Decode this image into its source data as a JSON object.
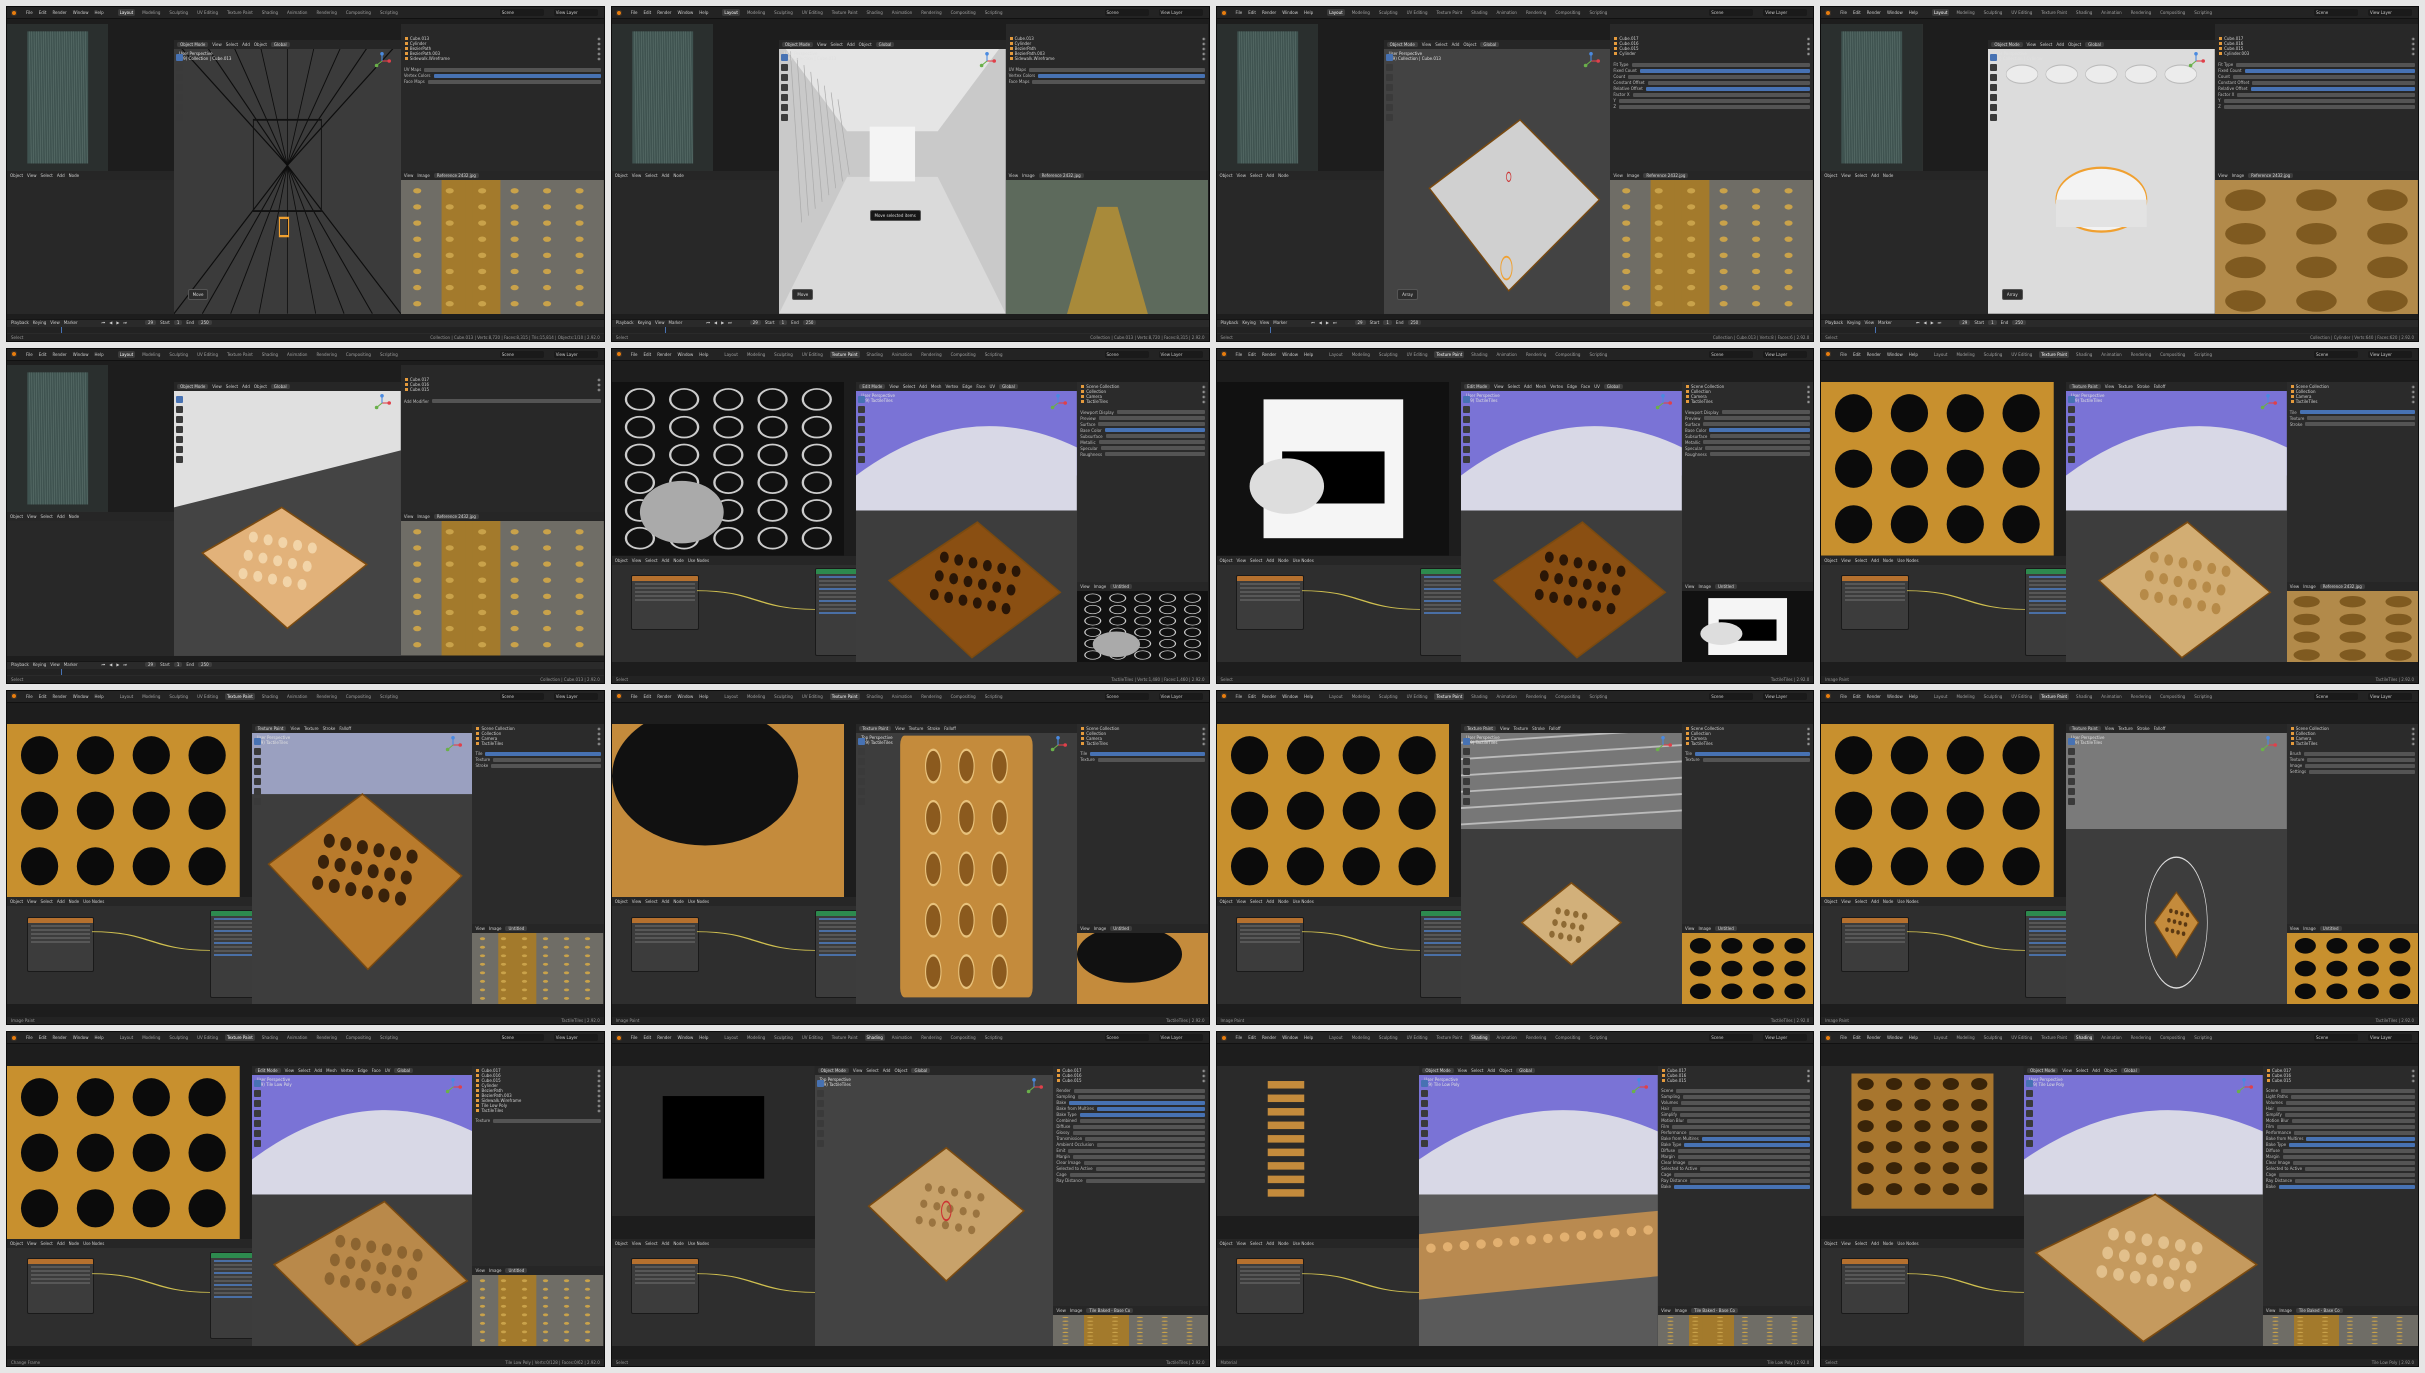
{
  "app": {
    "menu": [
      "File",
      "Edit",
      "Render",
      "Window",
      "Help"
    ],
    "workspaces": [
      "Layout",
      "Modeling",
      "Sculpting",
      "UV Editing",
      "Texture Paint",
      "Shading",
      "Animation",
      "Rendering",
      "Compositing",
      "Scripting"
    ],
    "scene": "Scene",
    "view_layer": "View Layer"
  },
  "colors": {
    "accent": "#4772b3",
    "tile_orange": "#c7882c",
    "blender_orange": "#e87d0d",
    "ui_dark": "#1d1d1d",
    "ui_panel": "#303030",
    "sky_purple": "#7a73d6"
  },
  "frames": [
    {
      "workspace": "Layout",
      "mode": "Object Mode",
      "header": [
        "View",
        "Select",
        "Add",
        "Object"
      ],
      "orientation": "Global",
      "caption": [
        "User Perspective",
        "(29) Collection | Cube.013"
      ],
      "scene_kind": "wireframe",
      "outliner": [
        "Cube.013",
        "Cylinder",
        "BezierPath",
        "BezierPath.003",
        "Sidewalk.Wireframe"
      ],
      "props": [
        "UV Maps",
        "Vertex Colors",
        "Face Maps"
      ],
      "image_title": "Reference 2432.jpg",
      "ref_kind": "tiles",
      "panel_label": "Move",
      "timeline": [
        "Playback",
        "Keying",
        "View",
        "Marker"
      ],
      "status_left": "Select",
      "status_right": "Collection | Cube.013 | Verts:8,720 | Faces:8,315 | Tris:15,814 | Objects:1/10 | 2.92.0",
      "frame_current": "29",
      "frame_start": "1",
      "frame_end": "250"
    },
    {
      "workspace": "Layout",
      "mode": "Object Mode",
      "header": [
        "View",
        "Select",
        "Add",
        "Object"
      ],
      "orientation": "Global",
      "caption": [
        "User Perspective",
        "(29) Collection | Cube.013"
      ],
      "scene_kind": "corridor",
      "outliner": [
        "Cube.013",
        "Cylinder",
        "BezierPath",
        "BezierPath.003",
        "Sidewalk.Wireframe"
      ],
      "props": [
        "UV Maps",
        "Vertex Colors",
        "Face Maps"
      ],
      "image_title": "Reference 2432.jpg",
      "ref_kind": "corridor",
      "tooltip": "Move selected items",
      "panel_label": "Move",
      "timeline": [
        "Playback",
        "Keying",
        "View",
        "Marker"
      ],
      "status_left": "Select",
      "status_right": "Collection | Cube.013 | Verts:8,720 | Faces:8,315 | 2.92.0",
      "frame_current": "29",
      "frame_start": "1",
      "frame_end": "250"
    },
    {
      "workspace": "Layout",
      "mode": "Object Mode",
      "header": [
        "View",
        "Select",
        "Add",
        "Object"
      ],
      "orientation": "Global",
      "caption": [
        "User Perspective",
        "(29) Collection | Cube.013"
      ],
      "scene_kind": "plane",
      "outliner": [
        "Cube.017",
        "Cube.016",
        "Cube.015",
        "Cylinder"
      ],
      "props": [
        "Fit Type",
        "Fixed Count",
        "Count",
        "Constant Offset",
        "Relative Offset",
        "Factor X",
        "Y",
        "Z"
      ],
      "image_title": "Reference 2432.jpg",
      "ref_kind": "tiles",
      "panel_label": "Array",
      "timeline": [
        "Playback",
        "Keying",
        "View",
        "Marker"
      ],
      "status_left": "Select",
      "status_right": "Collection | Cube.013 | Verts:8 | Faces:6 | 2.92.0",
      "frame_current": "29",
      "frame_start": "1",
      "frame_end": "250"
    },
    {
      "workspace": "Layout",
      "mode": "Object Mode",
      "header": [
        "View",
        "Select",
        "Add",
        "Object"
      ],
      "orientation": "Global",
      "caption": [
        "User Perspective",
        "(29) Collection | Cylinder"
      ],
      "scene_kind": "bumps",
      "outliner": [
        "Cube.017",
        "Cube.016",
        "Cube.015",
        "Cylinder.003"
      ],
      "props": [
        "Fit Type",
        "Fixed Count",
        "Count",
        "Constant Offset",
        "Relative Offset",
        "Factor X",
        "Y",
        "Z"
      ],
      "image_title": "Reference 2432.jpg",
      "ref_kind": "closeup",
      "panel_label": "Array",
      "timeline": [
        "Playback",
        "Keying",
        "View",
        "Marker"
      ],
      "status_left": "Select",
      "status_right": "Collection | Cylinder | Verts:640 | Faces:620 | 2.92.0",
      "frame_current": "29",
      "frame_start": "1",
      "frame_end": "250"
    },
    {
      "workspace": "Layout",
      "mode": "Object Mode",
      "header": [
        "View",
        "Select",
        "Add",
        "Object"
      ],
      "orientation": "Global",
      "caption": [
        "User Perspective",
        "(29) Collection | Cube.013"
      ],
      "scene_kind": "tile_mesh",
      "outliner": [
        "Cube.017",
        "Cube.016",
        "Cube.015"
      ],
      "props": [
        "Add Modifier"
      ],
      "image_title": "Reference 2432.jpg",
      "ref_kind": "tiles",
      "panel_label": "",
      "timeline": [
        "Playback",
        "Keying",
        "View",
        "Marker"
      ],
      "status_left": "Select",
      "status_right": "Collection | Cube.013 | 2.92.0",
      "frame_current": "29",
      "frame_start": "1",
      "frame_end": "250"
    },
    {
      "workspace": "Texture Paint",
      "mode": "Edit Mode",
      "header": [
        "View",
        "Select",
        "Add",
        "Mesh",
        "Vertex",
        "Edge",
        "Face",
        "UV"
      ],
      "orientation": "Global",
      "caption": [
        "User Perspective",
        "(29) TactileTiles"
      ],
      "scene_kind": "dark_tile",
      "outliner": [
        "Scene Collection",
        "Collection",
        "Camera",
        "TactileTiles"
      ],
      "props": [
        "Viewport Display",
        "Preview",
        "Surface",
        "Base Color",
        "Subsurface",
        "Metallic",
        "Specular",
        "Roughness"
      ],
      "image_title": "Untitled",
      "ref_kind": "uv_circles",
      "panel_label": "",
      "timeline": [],
      "status_left": "Select",
      "status_right": "TactileTiles | Verts:1,480 | Faces:1,460 | 2.92.0",
      "frame_current": "",
      "frame_start": "",
      "frame_end": ""
    },
    {
      "workspace": "Texture Paint",
      "mode": "Edit Mode",
      "header": [
        "View",
        "Select",
        "Add",
        "Mesh",
        "Vertex",
        "Edge",
        "Face",
        "UV"
      ],
      "orientation": "Global",
      "caption": [
        "User Perspective",
        "(29) TactileTiles"
      ],
      "scene_kind": "dark_tile",
      "outliner": [
        "Scene Collection",
        "Collection",
        "Camera",
        "TactileTiles"
      ],
      "props": [
        "Viewport Display",
        "Preview",
        "Surface",
        "Base Color",
        "Subsurface",
        "Metallic",
        "Specular",
        "Roughness"
      ],
      "image_title": "Untitled",
      "ref_kind": "uv_bw",
      "panel_label": "",
      "timeline": [],
      "status_left": "Select",
      "status_right": "TactileTiles | 2.92.0",
      "frame_current": "",
      "frame_start": "",
      "frame_end": ""
    },
    {
      "workspace": "Texture Paint",
      "mode": "Texture Paint",
      "header": [
        "View",
        "Texture",
        "Stroke",
        "Falloff"
      ],
      "orientation": "",
      "caption": [
        "User Perspective",
        "(29) TactileTiles"
      ],
      "scene_kind": "light_tile",
      "outliner": [
        "Scene Collection",
        "Collection",
        "Camera",
        "TactileTiles"
      ],
      "props": [
        "Tile",
        "Texture",
        "Stroke"
      ],
      "image_title": "Reference 2432.jpg",
      "ref_kind": "closeup",
      "panel_label": "",
      "timeline": [],
      "status_left": "Image Paint",
      "status_right": "TactileTiles | 2.92.0",
      "frame_current": "",
      "frame_start": "",
      "frame_end": ""
    },
    {
      "workspace": "Texture Paint",
      "mode": "Texture Paint",
      "header": [
        "View",
        "Texture",
        "Stroke",
        "Falloff"
      ],
      "orientation": "",
      "caption": [
        "User Perspective",
        "(29) TactileTiles"
      ],
      "scene_kind": "orange_tile",
      "outliner": [
        "Scene Collection",
        "Collection",
        "Camera",
        "TactileTiles"
      ],
      "props": [
        "Tile",
        "Texture",
        "Stroke"
      ],
      "image_title": "Untitled",
      "ref_kind": "tiles",
      "panel_label": "",
      "timeline": [],
      "status_left": "Image Paint",
      "status_right": "TactileTiles | 2.92.0",
      "frame_current": "",
      "frame_start": "",
      "frame_end": ""
    },
    {
      "workspace": "Texture Paint",
      "mode": "Texture Paint",
      "header": [
        "View",
        "Texture",
        "Stroke",
        "Falloff"
      ],
      "orientation": "",
      "caption": [
        "Top Perspective",
        "(29) TactileTiles"
      ],
      "scene_kind": "top_tile",
      "outliner": [
        "Scene Collection",
        "Collection",
        "Camera",
        "TactileTiles"
      ],
      "props": [
        "Tile",
        "Texture"
      ],
      "image_title": "Untitled",
      "ref_kind": "dot_closeup",
      "panel_label": "",
      "timeline": [],
      "status_left": "Image Paint",
      "status_right": "TactileTiles | 2.92.0",
      "frame_current": "",
      "frame_start": "",
      "frame_end": ""
    },
    {
      "workspace": "Texture Paint",
      "mode": "Texture Paint",
      "header": [
        "View",
        "Texture",
        "Stroke",
        "Falloff"
      ],
      "orientation": "",
      "caption": [
        "User Perspective",
        "(29) TactileTiles"
      ],
      "scene_kind": "small_tile",
      "outliner": [
        "Scene Collection",
        "Collection",
        "Camera",
        "TactileTiles"
      ],
      "props": [
        "Tile",
        "Texture"
      ],
      "image_title": "Untitled",
      "ref_kind": "dots",
      "panel_label": "",
      "timeline": [],
      "status_left": "Image Paint",
      "status_right": "TactileTiles | 2.92.0",
      "frame_current": "",
      "frame_start": "",
      "frame_end": ""
    },
    {
      "workspace": "Texture Paint",
      "mode": "Texture Paint",
      "header": [
        "View",
        "Texture",
        "Stroke",
        "Falloff"
      ],
      "orientation": "",
      "caption": [
        "User Perspective",
        "(29) TactileTiles"
      ],
      "scene_kind": "brush_tile",
      "outliner": [
        "Scene Collection",
        "Collection",
        "Camera",
        "TactileTiles"
      ],
      "props": [
        "Brush",
        "Texture",
        "Image",
        "Settings"
      ],
      "image_title": "Untitled",
      "ref_kind": "dots",
      "panel_label": "",
      "timeline": [],
      "status_left": "Image Paint",
      "status_right": "TactileTiles | 2.92.0",
      "frame_current": "",
      "frame_start": "",
      "frame_end": ""
    },
    {
      "workspace": "Texture Paint",
      "mode": "Edit Mode",
      "header": [
        "View",
        "Select",
        "Add",
        "Mesh",
        "Vertex",
        "Edge",
        "Face",
        "UV"
      ],
      "orientation": "Global",
      "caption": [
        "User Perspective",
        "(29) Tile Low Poly"
      ],
      "scene_kind": "brown_tile",
      "outliner": [
        "Cube.017",
        "Cube.016",
        "Cube.015",
        "Cylinder",
        "BezierPath",
        "BezierPath.003",
        "Sidewalk.Wireframe",
        "Tile Low Poly",
        "TactileTiles"
      ],
      "props": [
        "Texture"
      ],
      "image_title": "Untitled",
      "ref_kind": "tiles",
      "panel_label": "",
      "timeline": [],
      "status_left": "Change Frame",
      "status_right": "Tile Low Poly | Verts:0/128 | Faces:0/62 | 2.92.0",
      "frame_current": "",
      "frame_start": "",
      "frame_end": ""
    },
    {
      "workspace": "Shading",
      "mode": "Object Mode",
      "header": [
        "View",
        "Select",
        "Add",
        "Object"
      ],
      "orientation": "Global",
      "caption": [
        "Top Perspective",
        "(29) TactileTiles"
      ],
      "scene_kind": "bake_tile",
      "outliner": [
        "Cube.017",
        "Cube.016",
        "Cube.015"
      ],
      "props": [
        "Render",
        "Sampling",
        "Bake",
        "Bake from Multires",
        "Bake Type",
        "Combined",
        "Diffuse",
        "Glossy",
        "Transmission",
        "Ambient Occlusion",
        "Emit",
        "Margin",
        "Clear Image",
        "Selected to Active",
        "Cage",
        "Ray Distance"
      ],
      "image_title": "Tile Baked - Base Co",
      "ref_kind": "black_square",
      "panel_label": "",
      "timeline": [],
      "status_left": "Select",
      "status_right": "TactileTiles | 2.92.0",
      "frame_current": "",
      "frame_start": "",
      "frame_end": ""
    },
    {
      "workspace": "Shading",
      "mode": "Object Mode",
      "header": [
        "View",
        "Select",
        "Add",
        "Object"
      ],
      "orientation": "Global",
      "caption": [
        "User Perspective",
        "(29) Tile Low Poly"
      ],
      "scene_kind": "scene_wide",
      "outliner": [
        "Cube.017",
        "Cube.016",
        "Cube.015"
      ],
      "props": [
        "Scene",
        "Sampling",
        "Volumes",
        "Hair",
        "Simplify",
        "Motion Blur",
        "Film",
        "Performance",
        "Bake from Multires",
        "Bake Type",
        "Diffuse",
        "Margin",
        "Clear Image",
        "Selected to Active",
        "Cage",
        "Ray Distance",
        "Bake"
      ],
      "image_title": "Tile Baked - Base Co",
      "ref_kind": "strip",
      "panel_label": "",
      "timeline": [],
      "status_left": "Material",
      "status_right": "Tile Low Poly | 2.92.0",
      "frame_current": "",
      "frame_start": "",
      "frame_end": ""
    },
    {
      "workspace": "Shading",
      "mode": "Object Mode",
      "header": [
        "View",
        "Select",
        "Add",
        "Object"
      ],
      "orientation": "Global",
      "caption": [
        "User Perspective",
        "(29) Tile Low Poly"
      ],
      "scene_kind": "scene_close",
      "outliner": [
        "Cube.017",
        "Cube.016",
        "Cube.015"
      ],
      "props": [
        "Scene",
        "Light Paths",
        "Volumes",
        "Hair",
        "Simplify",
        "Motion Blur",
        "Film",
        "Performance",
        "Bake from Multires",
        "Bake Type",
        "Diffuse",
        "Margin",
        "Clear Image",
        "Selected to Active",
        "Cage",
        "Ray Distance",
        "Bake"
      ],
      "image_title": "Tile Baked - Base Co",
      "ref_kind": "baked",
      "panel_label": "",
      "timeline": [],
      "status_left": "Select",
      "status_right": "Tile Low Poly | 2.92.0",
      "frame_current": "",
      "frame_start": "",
      "frame_end": ""
    }
  ]
}
